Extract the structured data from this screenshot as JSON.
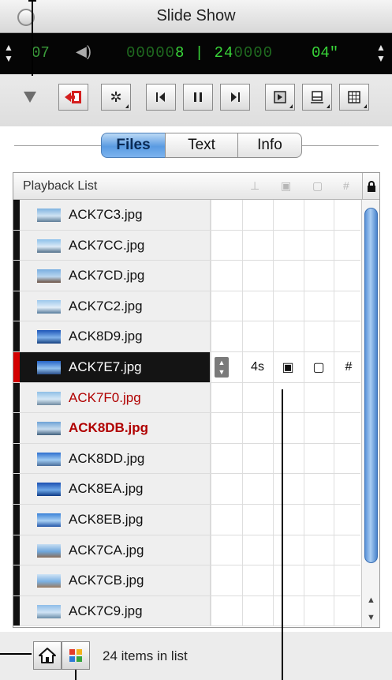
{
  "window": {
    "title": "Slide Show"
  },
  "lcd": {
    "index": "07",
    "counter_dim_prefix": "00000",
    "counter_current": "8",
    "counter_sep": " | ",
    "counter_total": "24",
    "counter_dim_suffix": "0000",
    "duration": "04\""
  },
  "tabs": [
    {
      "label": "Files",
      "active": true
    },
    {
      "label": "Text",
      "active": false
    },
    {
      "label": "Info",
      "active": false
    }
  ],
  "list": {
    "header": "Playback List",
    "rows": [
      {
        "name": "ACK7C3.jpg",
        "style": "normal"
      },
      {
        "name": "ACK7CC.jpg",
        "style": "normal"
      },
      {
        "name": "ACK7CD.jpg",
        "style": "normal"
      },
      {
        "name": "ACK7C2.jpg",
        "style": "normal"
      },
      {
        "name": "ACK8D9.jpg",
        "style": "normal"
      },
      {
        "name": "ACK7E7.jpg",
        "style": "selected",
        "duration": "4s"
      },
      {
        "name": "ACK7F0.jpg",
        "style": "red"
      },
      {
        "name": "ACK8DB.jpg",
        "style": "redbold"
      },
      {
        "name": "ACK8DD.jpg",
        "style": "normal"
      },
      {
        "name": "ACK8EA.jpg",
        "style": "normal"
      },
      {
        "name": "ACK8EB.jpg",
        "style": "normal"
      },
      {
        "name": "ACK7CA.jpg",
        "style": "normal"
      },
      {
        "name": "ACK7CB.jpg",
        "style": "normal"
      },
      {
        "name": "ACK7C9.jpg",
        "style": "normal"
      }
    ]
  },
  "status": {
    "text": "24 items in list"
  },
  "icons": {
    "toolbar": [
      "remove-icon",
      "gear-icon",
      "previous-icon",
      "pause-icon",
      "next-icon",
      "transition-icon",
      "layout-icon",
      "grid-icon"
    ],
    "bottom": [
      "home-icon",
      "color-palette-icon"
    ]
  },
  "colors": {
    "lcd_green": "#39d639",
    "selection_bar": "#d40000",
    "accent_blue": "#5a9be2",
    "red_text": "#b00000"
  }
}
